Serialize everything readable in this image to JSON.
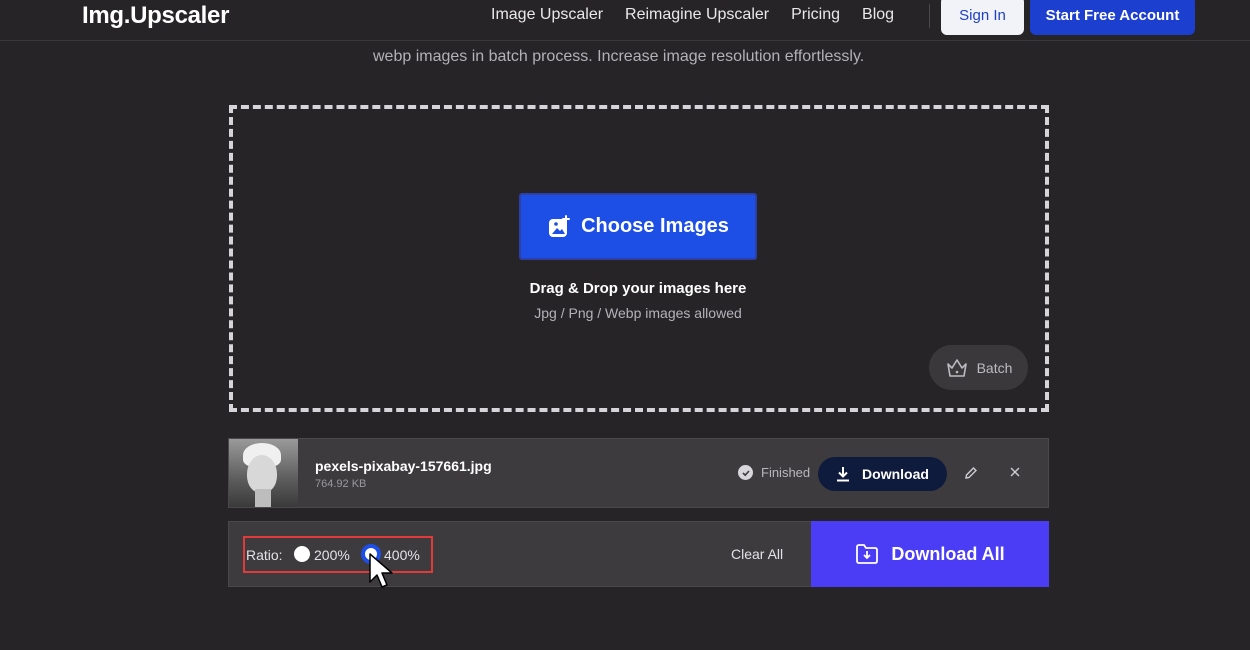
{
  "header": {
    "logo": "Img.Upscaler",
    "nav": [
      "Image Upscaler",
      "Reimagine Upscaler",
      "Pricing",
      "Blog"
    ],
    "sign_in": "Sign In",
    "start_free": "Start Free Account"
  },
  "hero": {
    "subtitle": "webp images in batch process. Increase image resolution effortlessly."
  },
  "dropzone": {
    "choose_label": "Choose Images",
    "drag_title": "Drag & Drop your images here",
    "allowed": "Jpg / Png / Webp images allowed",
    "batch_label": "Batch"
  },
  "file": {
    "name": "pexels-pixabay-157661.jpg",
    "size": "764.92 KB",
    "status": "Finished",
    "download_label": "Download"
  },
  "bottom": {
    "ratio_label": "Ratio:",
    "option_1": "200%",
    "option_2": "400%",
    "selected": "400%",
    "clear_all": "Clear All",
    "download_all": "Download All"
  },
  "colors": {
    "background": "#262427",
    "primary_blue": "#1d4ee6",
    "download_all": "#4a3df5",
    "highlight": "#e03a3a"
  }
}
